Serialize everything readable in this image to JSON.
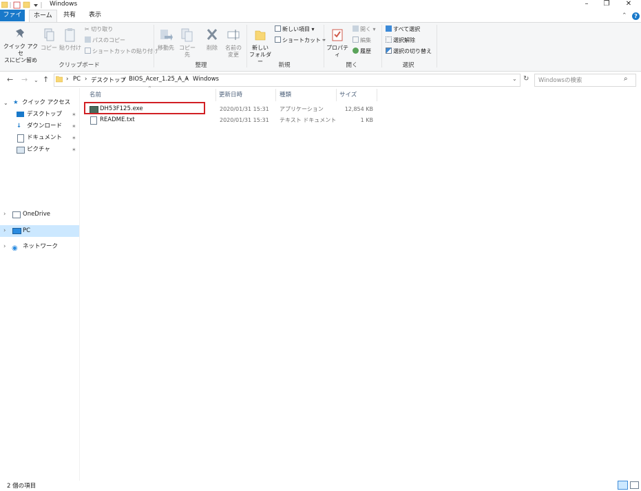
{
  "window": {
    "title": "Windows",
    "minimize_icon": "minimize-icon",
    "maximize_icon": "restore-icon",
    "close_icon": "close-icon"
  },
  "tabs": {
    "file": "ファイル",
    "home": "ホーム",
    "share": "共有",
    "view": "表示"
  },
  "ribbon": {
    "clipboard": {
      "pin_label": "クイック アクセ スにピン留め",
      "pin_line1": "クイック アクセ",
      "pin_line2": "スにピン留め",
      "copy": "コピー",
      "paste": "貼り付け",
      "cut": "切り取り",
      "copy_path": "パスのコピー",
      "paste_shortcut": "ショートカットの貼り付け",
      "group": "クリップボード"
    },
    "organize": {
      "move_to": "移動先",
      "copy_to": "コピー先",
      "delete": "削除",
      "rename_line1": "名前の",
      "rename_line2": "変更",
      "group": "整理"
    },
    "new": {
      "new_folder_line1": "新しい",
      "new_folder_line2": "フォルダー",
      "new_item": "新しい項目 ▾",
      "easy_access": "ショートカット ▾",
      "group": "新規"
    },
    "open": {
      "properties": "プロパティ",
      "open": "開く ▾",
      "edit": "編集",
      "history": "履歴",
      "group": "開く"
    },
    "select": {
      "select_all": "すべて選択",
      "select_none": "選択解除",
      "invert": "選択の切り替え",
      "group": "選択"
    }
  },
  "address": {
    "crumbs": [
      "PC",
      "デスクトップ",
      "BIOS_Acer_1.25_A_A",
      "Windows"
    ],
    "search_placeholder": "Windowsの検索"
  },
  "nav": {
    "quick_access": "クイック アクセス",
    "desktop": "デスクトップ",
    "downloads": "ダウンロード",
    "documents": "ドキュメント",
    "pictures": "ピクチャ",
    "onedrive": "OneDrive",
    "pc": "PC",
    "network": "ネットワーク"
  },
  "columns": {
    "name": "名前",
    "modified": "更新日時",
    "type": "種類",
    "size": "サイズ"
  },
  "files": [
    {
      "name": "DH53F125.exe",
      "modified": "2020/01/31 15:31",
      "type": "アプリケーション",
      "size": "12,854 KB"
    },
    {
      "name": "README.txt",
      "modified": "2020/01/31 15:31",
      "type": "テキスト ドキュメント",
      "size": "1 KB"
    }
  ],
  "status": {
    "count": "2 個の項目"
  },
  "colors": {
    "accent": "#1979ca",
    "highlight": "#d11f23",
    "selection": "#cce8ff"
  }
}
